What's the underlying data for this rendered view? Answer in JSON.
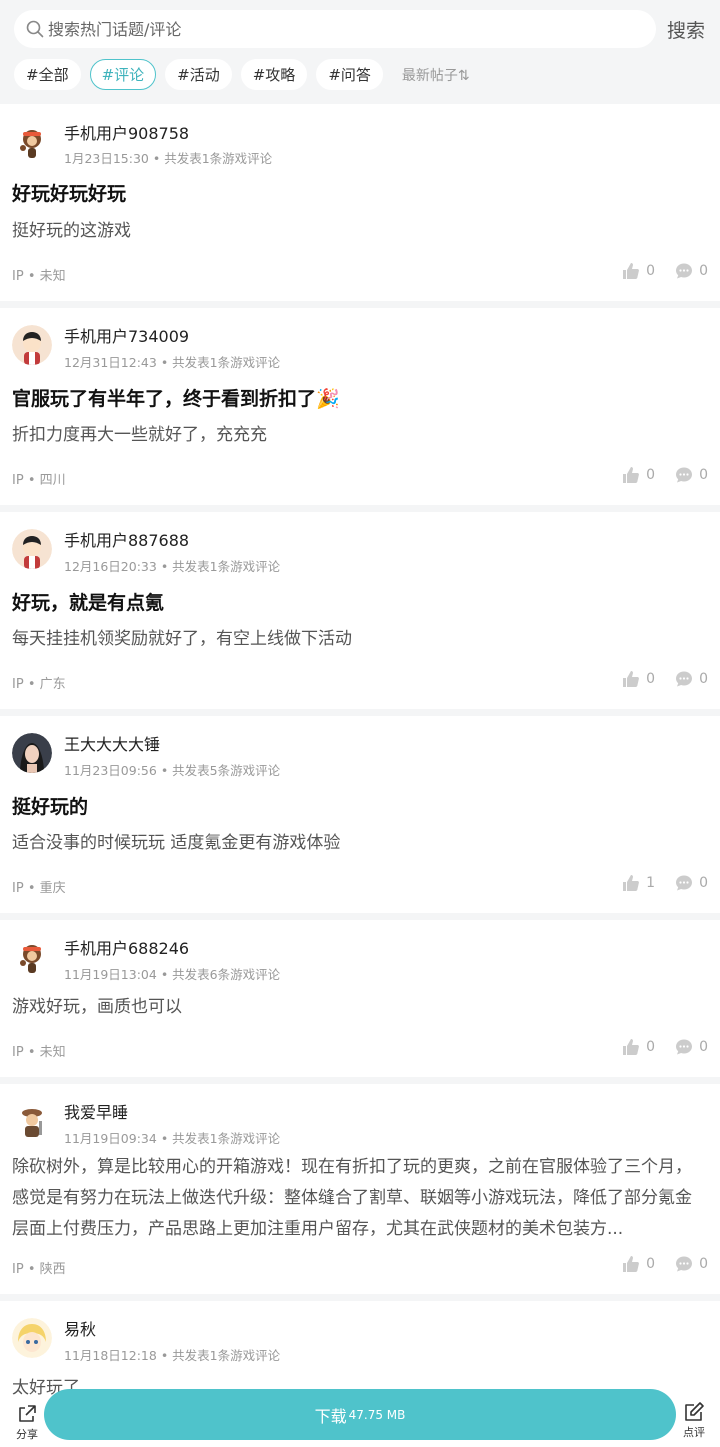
{
  "search": {
    "placeholder": "搜索热门话题/评论",
    "button_label": "搜索"
  },
  "tags": [
    "#全部",
    "#评论",
    "#活动",
    "#攻略",
    "#问答"
  ],
  "active_tag": "#评论",
  "sort_label": "最新帖子⇅",
  "posts": [
    {
      "username": "手机用户908758",
      "time": "1月23日15:30",
      "stat": "共发表1条游戏评论",
      "title": "好玩好玩好玩",
      "content": "挺好玩的这游戏",
      "ip": "未知",
      "likes": "0",
      "comments": "0",
      "avatar": "monkey-avatar"
    },
    {
      "username": "手机用户734009",
      "time": "12月31日12:43",
      "stat": "共发表1条游戏评论",
      "title": "官服玩了有半年了，终于看到折扣了🎉",
      "content": "折扣力度再大一些就好了，充充充",
      "ip": "四川",
      "likes": "0",
      "comments": "0",
      "avatar": "boy-avatar"
    },
    {
      "username": "手机用户887688",
      "time": "12月16日20:33",
      "stat": "共发表1条游戏评论",
      "title": "好玩，就是有点氪",
      "content": "每天挂挂机领奖励就好了，有空上线做下活动",
      "ip": "广东",
      "likes": "0",
      "comments": "0",
      "avatar": "boy-avatar"
    },
    {
      "username": "王大大大大锤",
      "time": "11月23日09:56",
      "stat": "共发表5条游戏评论",
      "title": "挺好玩的",
      "content": "适合没事的时候玩玩 适度氪金更有游戏体验",
      "ip": "重庆",
      "likes": "1",
      "comments": "0",
      "avatar": "girl-photo-avatar"
    },
    {
      "username": "手机用户688246",
      "time": "11月19日13:04",
      "stat": "共发表6条游戏评论",
      "title": "",
      "content": "游戏好玩，画质也可以",
      "ip": "未知",
      "likes": "0",
      "comments": "0",
      "avatar": "monkey-avatar"
    },
    {
      "username": "我爱早睡",
      "time": "11月19日09:34",
      "stat": "共发表1条游戏评论",
      "title": "",
      "content": "除砍树外，算是比较用心的开箱游戏！现在有折扣了玩的更爽，之前在官服体验了三个月，感觉是有努力在玩法上做迭代升级：整体缝合了割草、联姻等小游戏玩法，降低了部分氪金层面上付费压力，产品思路上更加注重用户留存，尤其在武侠题材的美术包装方...",
      "ip": "陕西",
      "likes": "0",
      "comments": "0",
      "avatar": "warrior-avatar"
    },
    {
      "username": "易秋",
      "time": "11月18日12:18",
      "stat": "共发表1条游戏评论",
      "title": "",
      "content": "太好玩了",
      "ip": "",
      "likes": "",
      "comments": "",
      "avatar": "anime-avatar"
    }
  ],
  "ip_prefix": "IP",
  "bottom": {
    "share_label": "分享",
    "download_label": "下载",
    "download_size": "47.75 MB",
    "review_label": "点评"
  },
  "colors": {
    "accent": "#4fc3cb",
    "background": "#f4f5f6"
  }
}
